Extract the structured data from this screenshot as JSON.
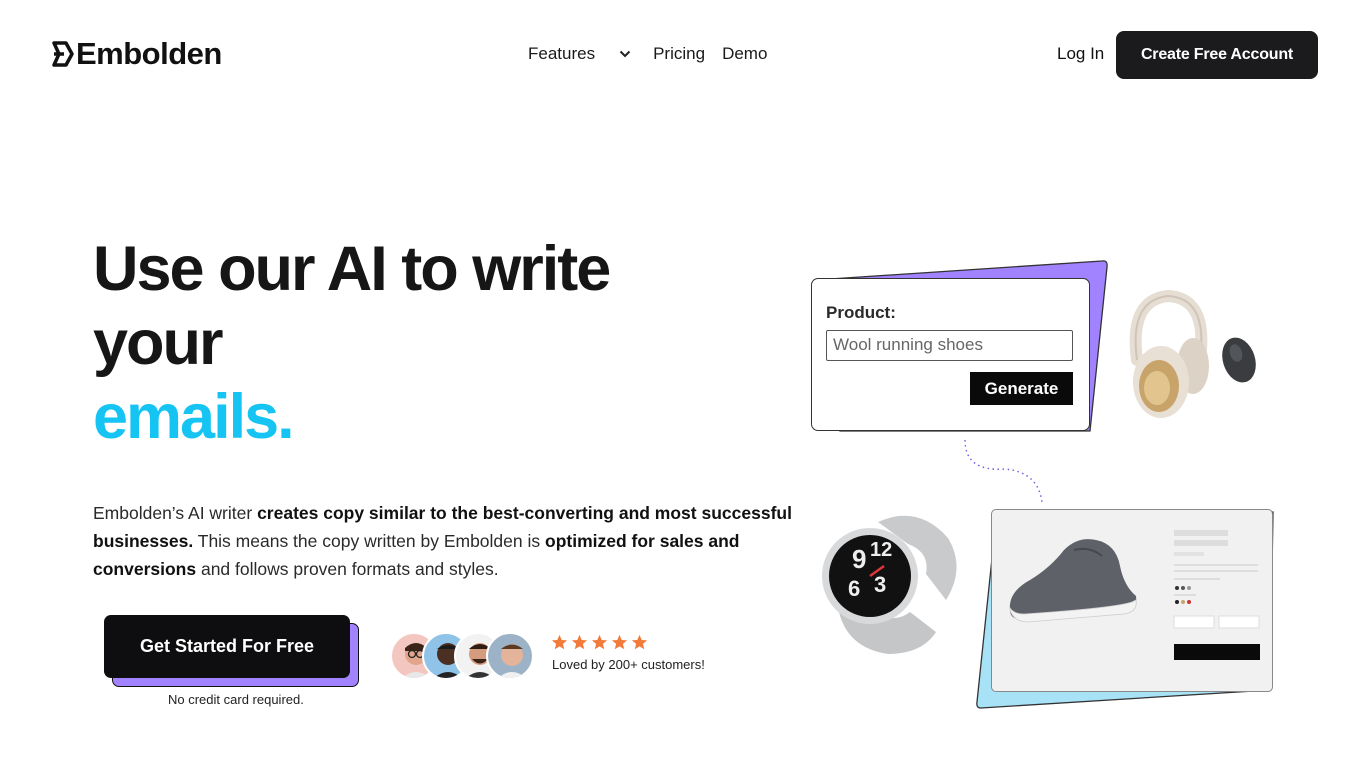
{
  "brand": {
    "name": "Embolden",
    "accent": "#16c4f4",
    "purple": "#a183ff",
    "light_blue": "#a8e2f6"
  },
  "nav": {
    "features": "Features",
    "pricing": "Pricing",
    "demo": "Demo",
    "login": "Log In",
    "cta": "Create Free Account"
  },
  "hero": {
    "headline_line1": "Use our AI to write",
    "headline_line2": "your",
    "headline_accent": "emails.",
    "desc_1": "Embolden’s AI writer ",
    "desc_2": "creates copy similar to the best-converting and most successful businesses.",
    "desc_3": " This means the copy written by Embolden is ",
    "desc_4": "optimized for sales and conversions",
    "desc_5": " and follows proven formats and styles.",
    "cta": "Get Started For Free",
    "no_card": "No credit card required.",
    "rating_stars": 5,
    "loved": "Loved by 200+ customers!"
  },
  "demo_card": {
    "label": "Product:",
    "input_value": "Wool running shoes",
    "button": "Generate"
  },
  "icons": [
    "embolden-logo-icon",
    "chevron-down-icon",
    "star-icon",
    "headphones-icon",
    "mouse-icon",
    "watch-icon",
    "shoe-icon"
  ]
}
